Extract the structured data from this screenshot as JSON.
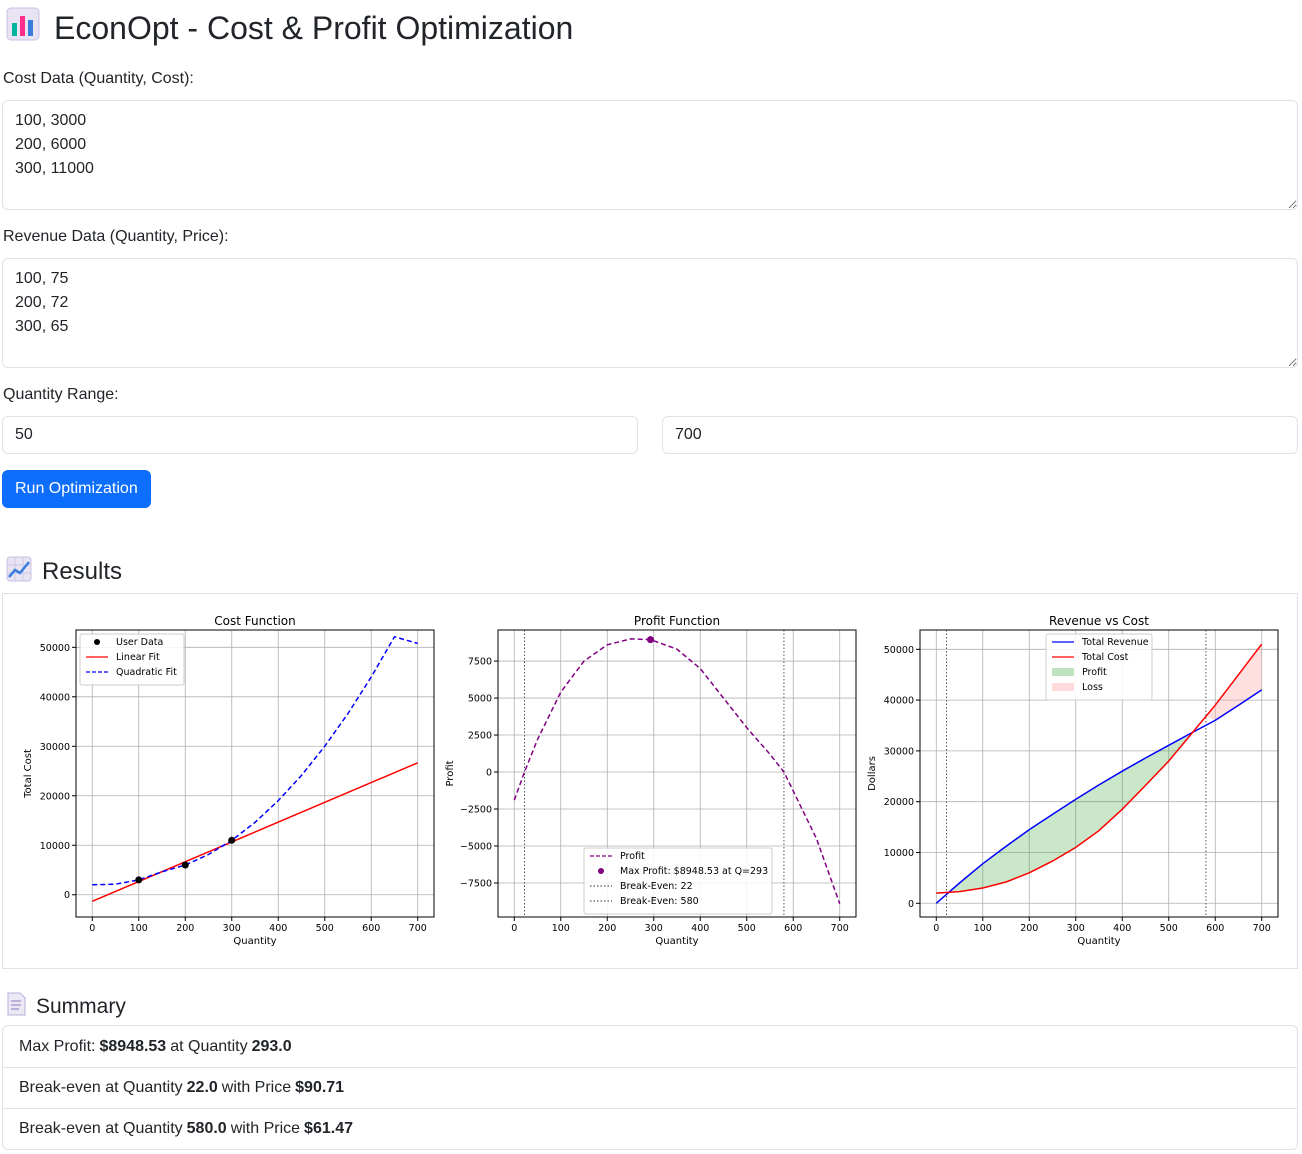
{
  "app": {
    "title": "EconOpt - Cost & Profit Optimization",
    "title_icon": "bar-chart-icon"
  },
  "form": {
    "cost_label": "Cost Data (Quantity, Cost):",
    "cost_value": "100, 3000\n200, 6000\n300, 11000",
    "revenue_label": "Revenue Data (Quantity, Price):",
    "revenue_value": "100, 75\n200, 72\n300, 65",
    "range_label": "Quantity Range:",
    "range_min": "50",
    "range_max": "700",
    "run_button": "Run Optimization"
  },
  "results": {
    "heading": "Results",
    "heading_icon": "line-chart-icon"
  },
  "summary": {
    "heading": "Summary",
    "heading_icon": "document-icon",
    "items": [
      {
        "a": "Max Profit:",
        "b": "$8948.53",
        "c": "at Quantity",
        "d": "293.0"
      },
      {
        "a": "Break-even at Quantity",
        "b": "22.0",
        "c": "with Price",
        "d": "$90.71"
      },
      {
        "a": "Break-even at Quantity",
        "b": "580.0",
        "c": "with Price",
        "d": "$61.47"
      }
    ]
  },
  "chart_data": [
    {
      "type": "line",
      "title": "Cost Function",
      "xlabel": "Quantity",
      "ylabel": "Total Cost",
      "xlim": [
        -35,
        735
      ],
      "ylim": [
        -4500,
        53500
      ],
      "xticks": [
        0,
        100,
        200,
        300,
        400,
        500,
        600,
        700
      ],
      "yticks": [
        0,
        10000,
        20000,
        30000,
        40000,
        50000
      ],
      "grid": true,
      "legend": "top-left",
      "points": {
        "name": "User Data",
        "x": [
          100,
          200,
          300
        ],
        "y": [
          3000,
          6000,
          11000
        ],
        "color": "#000000"
      },
      "series": [
        {
          "name": "Linear Fit",
          "color": "#ff0000",
          "dash": false,
          "x": [
            0,
            700
          ],
          "y": [
            -1333,
            26667
          ]
        },
        {
          "name": "Quadratic Fit",
          "color": "#0000ff",
          "dash": true,
          "x": [
            0,
            50,
            100,
            150,
            200,
            250,
            300,
            350,
            400,
            450,
            500,
            550,
            600,
            650,
            700
          ],
          "y": [
            2000,
            2125,
            3000,
            4625,
            6000,
            8125,
            11000,
            14625,
            19000,
            24125,
            30000,
            36625,
            44000,
            52125,
            50800
          ]
        }
      ]
    },
    {
      "type": "line",
      "title": "Profit Function",
      "xlabel": "Quantity",
      "ylabel": "Profit",
      "xlim": [
        -35,
        735
      ],
      "ylim": [
        -9800,
        9600
      ],
      "xticks": [
        0,
        100,
        200,
        300,
        400,
        500,
        600,
        700
      ],
      "yticks": [
        -7500,
        -5000,
        -2500,
        0,
        2500,
        5000,
        7500
      ],
      "grid": true,
      "legend": "bottom-center",
      "series": [
        {
          "name": "Profit",
          "color": "#800080",
          "dash": true,
          "x": [
            0,
            22,
            50,
            100,
            150,
            200,
            250,
            293,
            350,
            400,
            450,
            500,
            550,
            580,
            650,
            700
          ],
          "y": [
            -1900,
            0,
            2200,
            5400,
            7500,
            8600,
            9000,
            8948,
            8300,
            7000,
            5000,
            3000,
            1200,
            0,
            -4500,
            -8900
          ]
        }
      ],
      "marker": {
        "name": "Max Profit: $8948.53 at Q=293",
        "x": 293,
        "y": 8948.53,
        "color": "#800080"
      },
      "vlines": [
        {
          "name": "Break-Even: 22",
          "x": 22
        },
        {
          "name": "Break-Even: 580",
          "x": 580
        }
      ]
    },
    {
      "type": "area",
      "title": "Revenue vs Cost",
      "xlabel": "Quantity",
      "ylabel": "Dollars",
      "xlim": [
        -35,
        735
      ],
      "ylim": [
        -2700,
        53800
      ],
      "xticks": [
        0,
        100,
        200,
        300,
        400,
        500,
        600,
        700
      ],
      "yticks": [
        0,
        10000,
        20000,
        30000,
        40000,
        50000
      ],
      "grid": true,
      "legend": "top-center",
      "series": [
        {
          "name": "Total Revenue",
          "color": "#0000ff",
          "x": [
            0,
            50,
            100,
            150,
            200,
            250,
            300,
            350,
            400,
            450,
            500,
            550,
            600,
            650,
            700
          ],
          "y": [
            0,
            4000,
            7800,
            11200,
            14500,
            17500,
            20500,
            23300,
            26000,
            28600,
            31100,
            33600,
            36000,
            39000,
            42000
          ]
        },
        {
          "name": "Total Cost",
          "color": "#ff0000",
          "x": [
            0,
            50,
            100,
            150,
            200,
            250,
            300,
            350,
            400,
            450,
            500,
            550,
            600,
            650,
            700
          ],
          "y": [
            2000,
            2300,
            3000,
            4200,
            6000,
            8300,
            11000,
            14300,
            18500,
            23200,
            28000,
            33500,
            39000,
            45000,
            51000
          ]
        }
      ],
      "fills": [
        {
          "name": "Profit",
          "color": "#2ca02c"
        },
        {
          "name": "Loss",
          "color": "#ff9999"
        }
      ],
      "vlines": [
        {
          "x": 22
        },
        {
          "x": 580
        }
      ]
    }
  ]
}
